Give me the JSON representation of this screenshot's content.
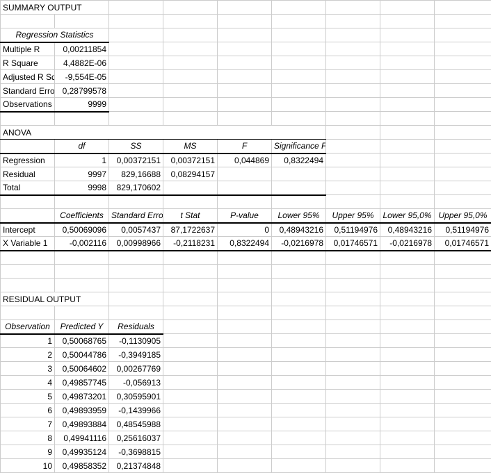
{
  "titles": {
    "summary": "SUMMARY OUTPUT",
    "regstats": "Regression Statistics",
    "anova": "ANOVA",
    "residual": "RESIDUAL OUTPUT"
  },
  "regstats": {
    "labels": [
      "Multiple R",
      "R Square",
      "Adjusted R Square",
      "Standard Error",
      "Observations"
    ],
    "values": [
      "0,00211854",
      "4,4882E-06",
      "-9,554E-05",
      "0,28799578",
      "9999"
    ]
  },
  "anova": {
    "headers": [
      "df",
      "SS",
      "MS",
      "F",
      "Significance F"
    ],
    "rows": [
      {
        "label": "Regression",
        "cells": [
          "1",
          "0,00372151",
          "0,00372151",
          "0,044869",
          "0,8322494"
        ]
      },
      {
        "label": "Residual",
        "cells": [
          "9997",
          "829,16688",
          "0,08294157",
          "",
          ""
        ]
      },
      {
        "label": "Total",
        "cells": [
          "9998",
          "829,170602",
          "",
          "",
          ""
        ]
      }
    ]
  },
  "coef": {
    "headers": [
      "Coefficients",
      "Standard Error",
      "t Stat",
      "P-value",
      "Lower 95%",
      "Upper 95%",
      "Lower 95,0%",
      "Upper 95,0%"
    ],
    "rows": [
      {
        "label": "Intercept",
        "cells": [
          "0,50069096",
          "0,0057437",
          "87,1722637",
          "0",
          "0,48943216",
          "0,51194976",
          "0,48943216",
          "0,51194976"
        ]
      },
      {
        "label": "X Variable 1",
        "cells": [
          "-0,002116",
          "0,00998966",
          "-0,2118231",
          "0,8322494",
          "-0,0216978",
          "0,01746571",
          "-0,0216978",
          "0,01746571"
        ]
      }
    ]
  },
  "resid": {
    "headers": [
      "Observation",
      "Predicted Y",
      "Residuals"
    ],
    "rows": [
      {
        "n": "1",
        "py": "0,50068765",
        "r": "-0,1130905"
      },
      {
        "n": "2",
        "py": "0,50044786",
        "r": "-0,3949185"
      },
      {
        "n": "3",
        "py": "0,50064602",
        "r": "0,00267769"
      },
      {
        "n": "4",
        "py": "0,49857745",
        "r": "-0,056913"
      },
      {
        "n": "5",
        "py": "0,49873201",
        "r": "0,30595901"
      },
      {
        "n": "6",
        "py": "0,49893959",
        "r": "-0,1439966"
      },
      {
        "n": "7",
        "py": "0,49893884",
        "r": "0,48545988"
      },
      {
        "n": "8",
        "py": "0,49941116",
        "r": "0,25616037"
      },
      {
        "n": "9",
        "py": "0,49935124",
        "r": "-0,3698815"
      },
      {
        "n": "10",
        "py": "0,49858352",
        "r": "0,21374848"
      }
    ]
  }
}
